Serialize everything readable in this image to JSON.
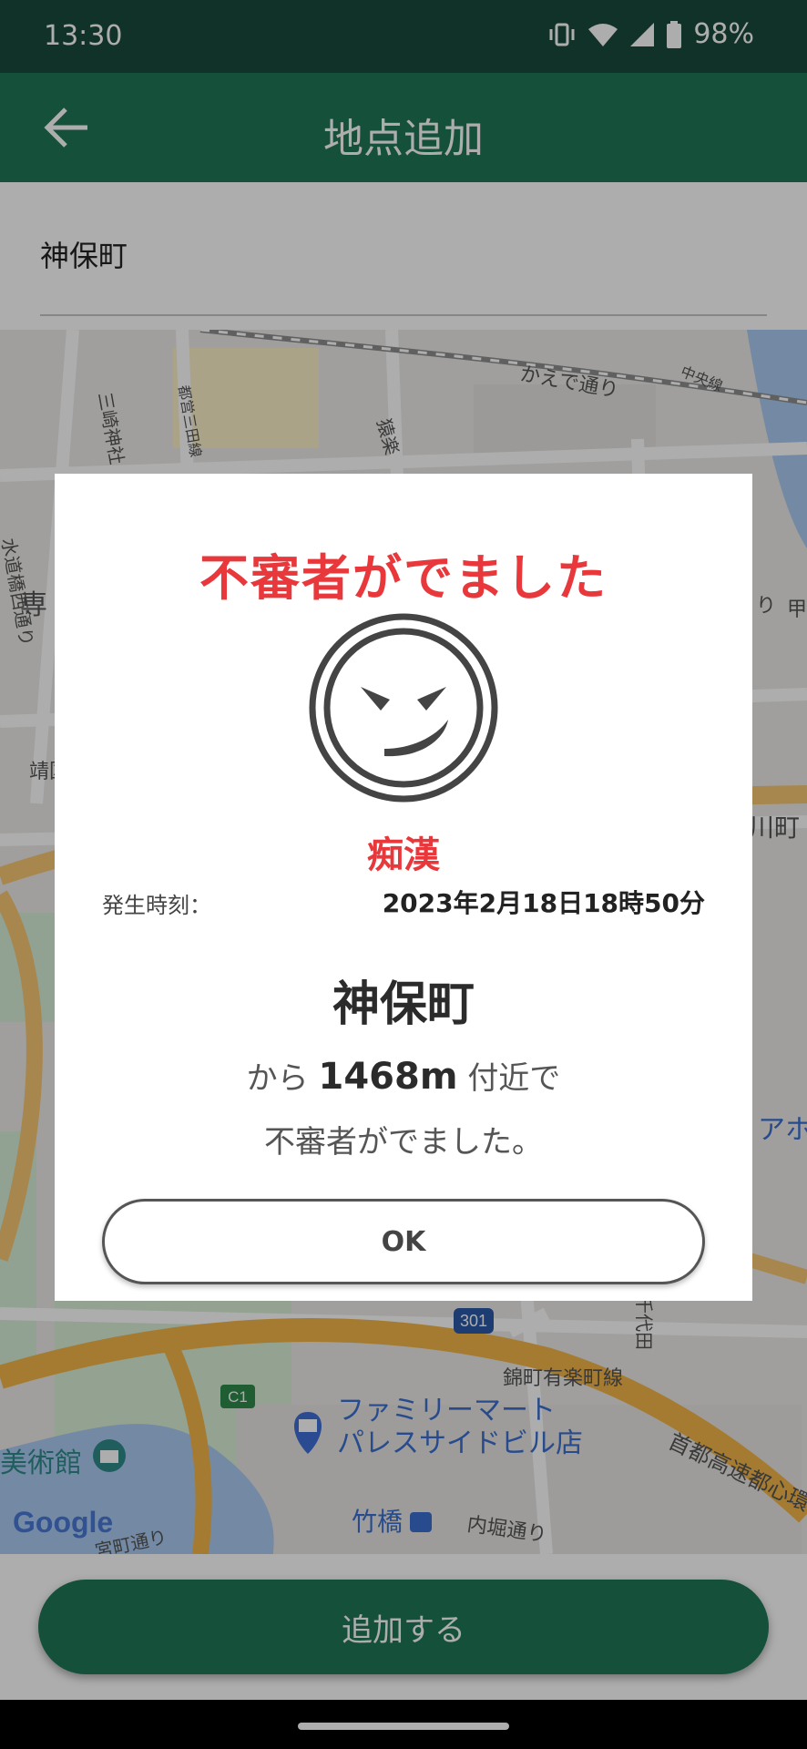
{
  "status_bar": {
    "time": "13:30",
    "battery": "98%"
  },
  "app_bar": {
    "title": "地点追加"
  },
  "search": {
    "value": "神保町"
  },
  "map": {
    "labels": {
      "kaede": "かえで通り",
      "chuo": "中央線",
      "misaki": "三崎神社",
      "toei": "都営三田線",
      "sarugaku": "猿楽",
      "suidobashi": "水道橋西通り",
      "sen": "専",
      "sei": "靖国",
      "ogawamachi": "川町",
      "aho": "アホ",
      "kou": "甲",
      "ri": "り",
      "route301": "301",
      "c1": "C1",
      "nishikicho": "錦町有楽町線",
      "chiyoda": "千代田",
      "famima": "ファミリーマート",
      "famima_branch": "パレスサイドビル店",
      "museum": "美術館",
      "expressway": "首都高速都心環状",
      "takebashi": "竹橋",
      "uchibori": "内堀通り",
      "miyamachi": "宮町通り",
      "google": "Google"
    }
  },
  "dialog": {
    "title": "不審者がでました",
    "icon": "sinister-face-icon",
    "incident_type": "痴漢",
    "time_label": "発生時刻：",
    "time_value": "2023年2月18日18時50分",
    "place": "神保町",
    "distance_prefix": "から",
    "distance_value": "1468m",
    "distance_suffix": "付近で",
    "message": "不審者がでました。",
    "ok_label": "OK"
  },
  "bottom": {
    "add_label": "追加する"
  },
  "colors": {
    "primary": "#1f7656",
    "status_bar": "#1a4a3c",
    "alert_red": "#e8383b"
  }
}
